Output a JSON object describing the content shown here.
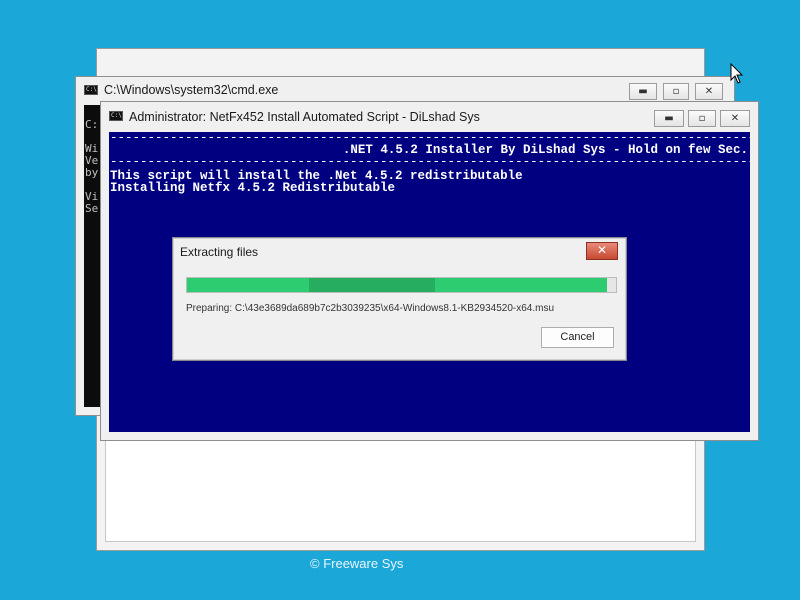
{
  "cmd_window": {
    "title": "C:\\Windows\\system32\\cmd.exe",
    "icon": "console-icon",
    "minimize": "▬",
    "maximize": "▫",
    "close": "✕",
    "console_lines": [
      "C:",
      "",
      "Wi",
      "Ve",
      "by",
      "",
      "Vi",
      "Se"
    ]
  },
  "admin_window": {
    "title": "Administrator:  NetFx452 Install Automated Script - DiLshad Sys",
    "icon": "console-icon",
    "minimize": "▬",
    "maximize": "▫",
    "close": "✕",
    "dash_line": "------------------------------------------------------------------------------------------------",
    "header_line": ".NET 4.5.2 Installer By DiLshad Sys - Hold on few Sec.",
    "line1": "This script will install the .Net 4.5.2 redistributable",
    "line2": "Installing Netfx 4.5.2 Redistributable"
  },
  "dialog": {
    "title": "Extracting files",
    "close": "✕",
    "progress_fraction": 1.0,
    "preparing_text": "Preparing: C:\\43e3689da689b7c2b3039235\\x64-Windows8.1-KB2934520-x64.msu",
    "cancel_label": "Cancel"
  },
  "footer": {
    "text": "©  Freeware Sys"
  },
  "colors": {
    "desktop": "#1ba7d8",
    "console_blue": "#000080",
    "progress_green": "#2ecc71"
  }
}
